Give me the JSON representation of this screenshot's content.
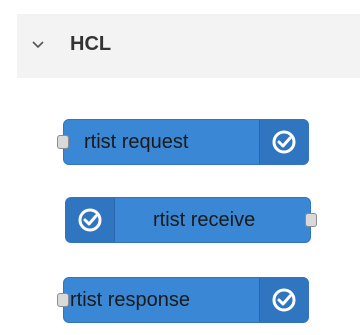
{
  "palette": {
    "category": "HCL",
    "nodes": [
      {
        "label": "rtist request",
        "port_side": "input",
        "icon": "check-circle-icon"
      },
      {
        "label": "rtist receive",
        "port_side": "output",
        "icon": "check-circle-icon"
      },
      {
        "label": "rtist response",
        "port_side": "input",
        "icon": "check-circle-icon"
      }
    ]
  }
}
